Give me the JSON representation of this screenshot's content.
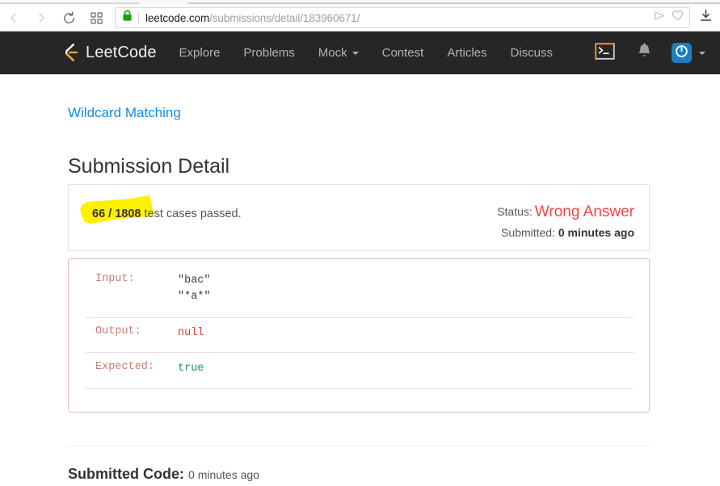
{
  "browser": {
    "back_icon": "back-arrow-icon",
    "forward_icon": "forward-arrow-icon",
    "reload_icon": "reload-icon",
    "apps_icon": "grid-apps-icon",
    "lock_icon": "padlock-secure-icon",
    "url_host": "leetcode.com",
    "url_path": "/submissions/detail/183960671/",
    "url_full": "leetcode.com/submissions/detail/183960671/",
    "share_icon": "send-share-icon",
    "favorite_icon": "heart-favorite-icon",
    "download_icon": "download-icon"
  },
  "navbar": {
    "brand": "LeetCode",
    "brand_icon": "leetcode-logo-icon",
    "links": [
      {
        "label": "Explore",
        "has_caret": false
      },
      {
        "label": "Problems",
        "has_caret": false
      },
      {
        "label": "Mock",
        "has_caret": true
      },
      {
        "label": "Contest",
        "has_caret": false
      },
      {
        "label": "Articles",
        "has_caret": false
      },
      {
        "label": "Discuss",
        "has_caret": false
      }
    ],
    "terminal_icon": "terminal-console-icon",
    "bell_icon": "notification-bell-icon",
    "avatar_icon": "user-avatar-power-icon",
    "colors": {
      "background": "#262626",
      "link": "#b3b3b3",
      "brand_orange": "#f0a336",
      "avatar_blue": "#1b7fc4"
    }
  },
  "page": {
    "problem_link": "Wildcard Matching",
    "title": "Submission Detail"
  },
  "submission": {
    "test_cases_passed": "66 / 1808",
    "test_cases_suffix": " test cases passed.",
    "status_label": "Status:",
    "status_value": "Wrong Answer",
    "submitted_label": "Submitted:",
    "submitted_value": "0 minutes ago",
    "highlight_color": "#fff000",
    "status_color": "#ef4743"
  },
  "testcase": {
    "rows": [
      {
        "label": "Input:",
        "value": "\"bac\"\n\"*a*\"",
        "kind": "input"
      },
      {
        "label": "Output:",
        "value": "null",
        "kind": "output"
      },
      {
        "label": "Expected:",
        "value": "true",
        "kind": "expected"
      }
    ],
    "border_color": "#e7b9b9",
    "output_color": "#d04242",
    "expected_color": "#27914f"
  },
  "footer": {
    "submitted_code_label": "Submitted Code:",
    "submitted_code_time": "0 minutes ago"
  }
}
